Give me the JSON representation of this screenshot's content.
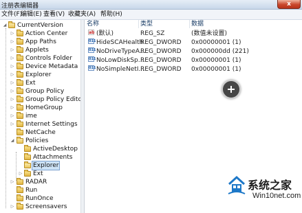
{
  "window": {
    "title": "注册表编辑器",
    "close_label": "x"
  },
  "menu": [
    {
      "label": "文件(F)"
    },
    {
      "label": "编辑(E)"
    },
    {
      "label": "查看(V)"
    },
    {
      "label": "收藏夹(A)"
    },
    {
      "label": "帮助(H)"
    }
  ],
  "tree": {
    "root": "CurrentVersion",
    "items": [
      {
        "label": "Action Center"
      },
      {
        "label": "App Paths"
      },
      {
        "label": "Applets"
      },
      {
        "label": "Controls Folder"
      },
      {
        "label": "Device Metadata"
      },
      {
        "label": "Explorer"
      },
      {
        "label": "Ext"
      },
      {
        "label": "Group Policy"
      },
      {
        "label": "Group Policy Editor"
      },
      {
        "label": "HomeGroup"
      },
      {
        "label": "ime"
      },
      {
        "label": "Internet Settings"
      },
      {
        "label": "NetCache"
      },
      {
        "label": "Policies"
      },
      {
        "label": "ActiveDesktop"
      },
      {
        "label": "Attachments"
      },
      {
        "label": "Explorer"
      },
      {
        "label": "Ext"
      },
      {
        "label": "RADAR"
      },
      {
        "label": "Run"
      },
      {
        "label": "RunOnce"
      },
      {
        "label": "Screensavers"
      }
    ],
    "selected": "Explorer"
  },
  "list": {
    "headers": {
      "name": "名称",
      "type": "类型",
      "data": "数据"
    },
    "rows": [
      {
        "icon": "string-value-icon",
        "icon_text": "ab",
        "name": "(默认)",
        "type": "REG_SZ",
        "data": "(数值未设置)"
      },
      {
        "icon": "dword-value-icon",
        "icon_text": "011",
        "name": "HideSCAHealth",
        "type": "REG_DWORD",
        "data": "0x00000001 (1)"
      },
      {
        "icon": "dword-value-icon",
        "icon_text": "011",
        "name": "NoDriveTypeA...",
        "type": "REG_DWORD",
        "data": "0x000000dd (221)"
      },
      {
        "icon": "dword-value-icon",
        "icon_text": "011",
        "name": "NoLowDiskSp...",
        "type": "REG_DWORD",
        "data": "0x00000001 (1)"
      },
      {
        "icon": "dword-value-icon",
        "icon_text": "011",
        "name": "NoSimpleNetI...",
        "type": "REG_DWORD",
        "data": "0x00000001 (1)"
      }
    ]
  },
  "watermark": {
    "brand": "系统之家",
    "site": "Win10net.com"
  },
  "colors": {
    "selection": "#cde3f7",
    "folder": "#e0b441",
    "accent": "#1a3d66"
  }
}
